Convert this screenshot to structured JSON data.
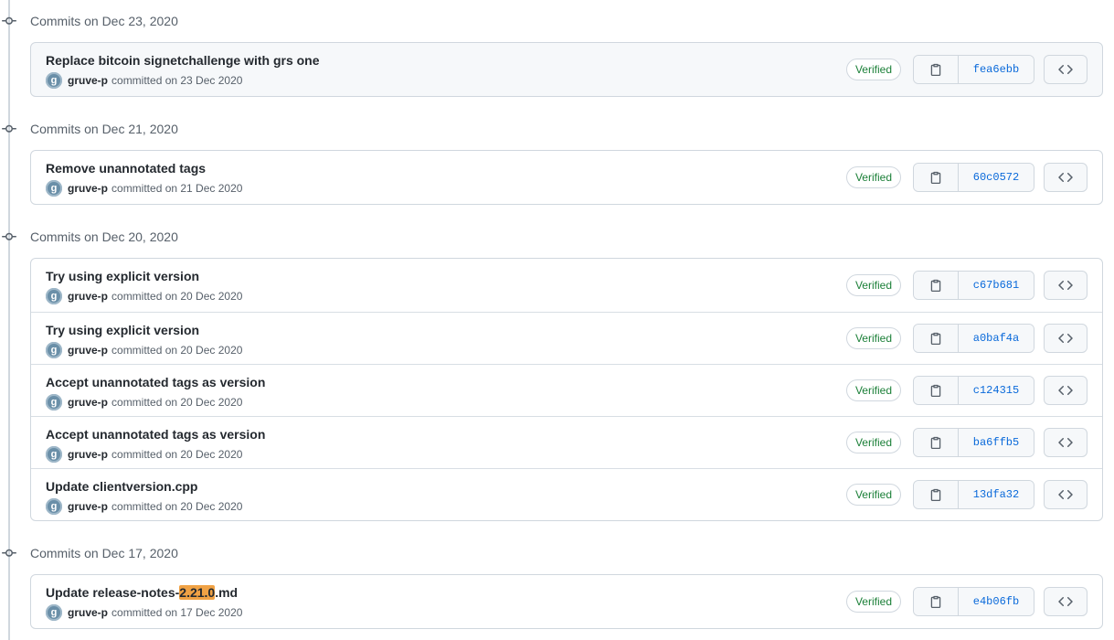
{
  "groups": [
    {
      "title": "Commits on Dec 23, 2020",
      "highlight": true,
      "commits": [
        {
          "title_before": "Replace bitcoin signetchallenge with grs one",
          "title_hl": "",
          "title_after": "",
          "author": "gruve-p",
          "meta": "committed on 23 Dec 2020",
          "verified": "Verified",
          "sha": "fea6ebb"
        }
      ]
    },
    {
      "title": "Commits on Dec 21, 2020",
      "highlight": false,
      "commits": [
        {
          "title_before": "Remove unannotated tags",
          "title_hl": "",
          "title_after": "",
          "author": "gruve-p",
          "meta": "committed on 21 Dec 2020",
          "verified": "Verified",
          "sha": "60c0572"
        }
      ]
    },
    {
      "title": "Commits on Dec 20, 2020",
      "highlight": false,
      "commits": [
        {
          "title_before": "Try using explicit version",
          "title_hl": "",
          "title_after": "",
          "author": "gruve-p",
          "meta": "committed on 20 Dec 2020",
          "verified": "Verified",
          "sha": "c67b681"
        },
        {
          "title_before": "Try using explicit version",
          "title_hl": "",
          "title_after": "",
          "author": "gruve-p",
          "meta": "committed on 20 Dec 2020",
          "verified": "Verified",
          "sha": "a0baf4a"
        },
        {
          "title_before": "Accept unannotated tags as version",
          "title_hl": "",
          "title_after": "",
          "author": "gruve-p",
          "meta": "committed on 20 Dec 2020",
          "verified": "Verified",
          "sha": "c124315"
        },
        {
          "title_before": "Accept unannotated tags as version",
          "title_hl": "",
          "title_after": "",
          "author": "gruve-p",
          "meta": "committed on 20 Dec 2020",
          "verified": "Verified",
          "sha": "ba6ffb5"
        },
        {
          "title_before": "Update clientversion.cpp",
          "title_hl": "",
          "title_after": "",
          "author": "gruve-p",
          "meta": "committed on 20 Dec 2020",
          "verified": "Verified",
          "sha": "13dfa32"
        }
      ]
    },
    {
      "title": "Commits on Dec 17, 2020",
      "highlight": false,
      "commits": [
        {
          "title_before": "Update release-notes-",
          "title_hl": "2.21.0",
          "title_after": ".md",
          "author": "gruve-p",
          "meta": "committed on 17 Dec 2020",
          "verified": "Verified",
          "sha": "e4b06fb"
        }
      ]
    }
  ],
  "avatar_letter": "g",
  "icons": {
    "node": "git-commit-icon",
    "copy": "clipboard-icon",
    "browse": "code-icon"
  },
  "colors": {
    "verified": "#1a7f37",
    "sha_link": "#0969da",
    "highlight": "#f0a245",
    "border": "#d0d7de"
  }
}
